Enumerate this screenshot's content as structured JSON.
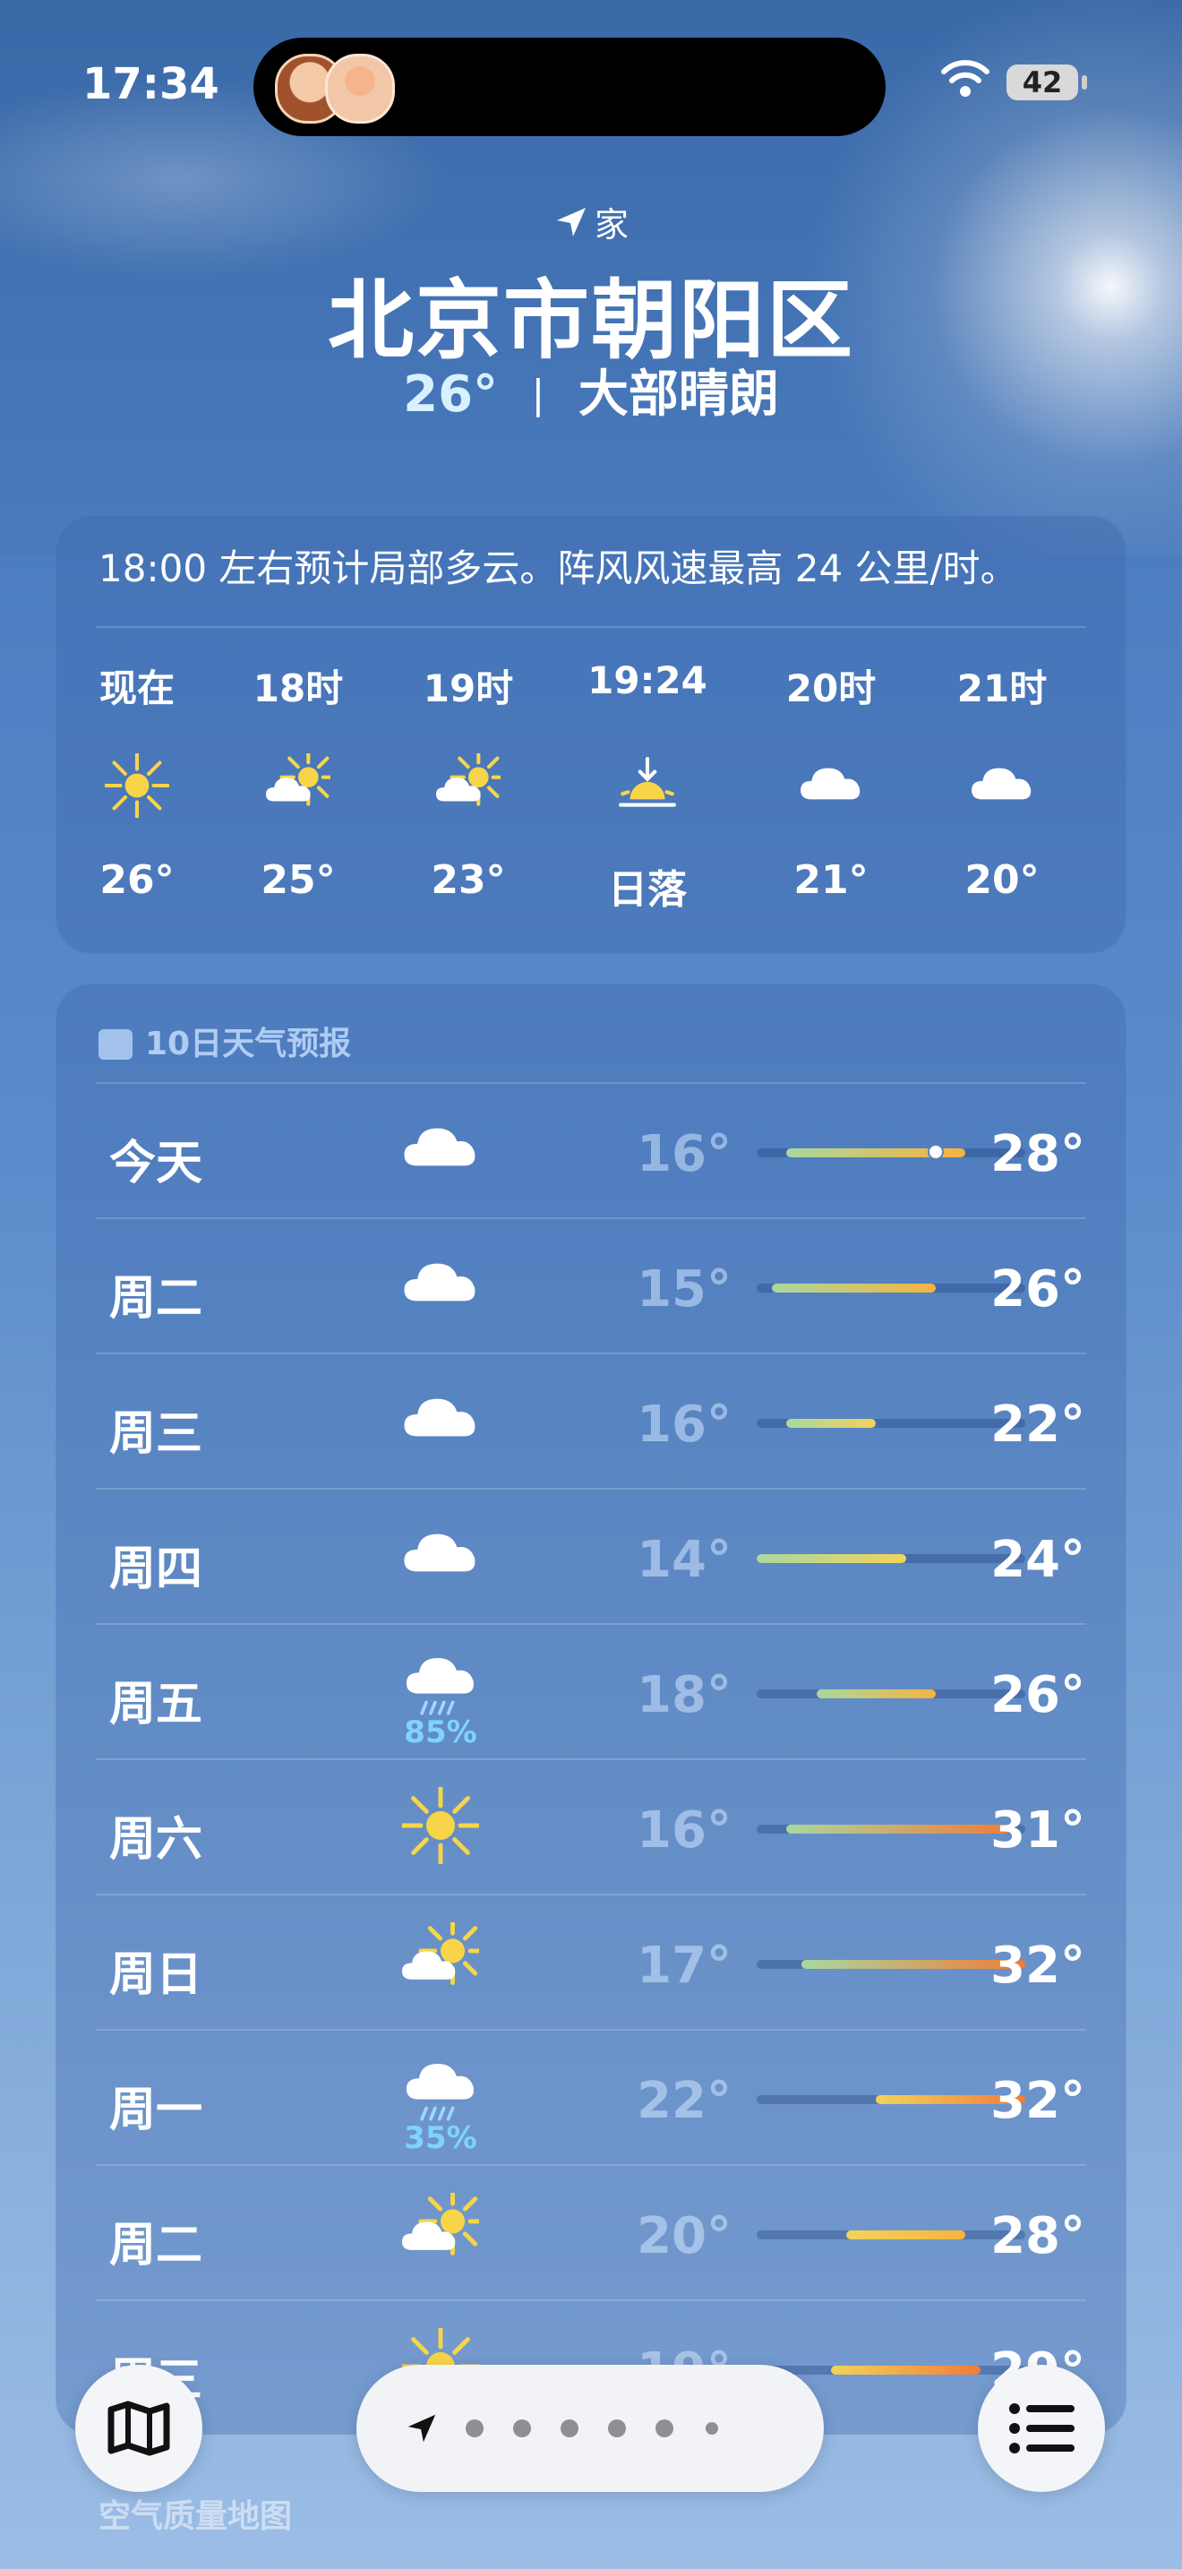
{
  "status": {
    "time": "17:34",
    "battery": "42"
  },
  "header": {
    "location_label": "家",
    "city": "北京市朝阳区",
    "current_temp": "26°",
    "separator": "|",
    "condition": "大部晴朗"
  },
  "hourly": {
    "summary": "18:00 左右预计局部多云。阵风风速最高 24 公里/时。",
    "items": [
      {
        "label": "现在",
        "icon": "sun-icon",
        "temp": "26°"
      },
      {
        "label": "18时",
        "icon": "partly-sunny-icon",
        "temp": "25°"
      },
      {
        "label": "19时",
        "icon": "partly-sunny-icon",
        "temp": "23°"
      },
      {
        "label": "19:24",
        "icon": "sunset-icon",
        "temp": "日落"
      },
      {
        "label": "20时",
        "icon": "cloud-icon",
        "temp": "21°"
      },
      {
        "label": "21时",
        "icon": "cloud-icon",
        "temp": "20°"
      }
    ]
  },
  "daily": {
    "title": "10日天气预报",
    "range": [
      14,
      32
    ],
    "current_temp_value": 26,
    "days": [
      {
        "name": "今天",
        "icon": "cloud-icon",
        "precip": "",
        "low": "16°",
        "high": "28°",
        "low_v": 16,
        "high_v": 28
      },
      {
        "name": "周二",
        "icon": "cloud-icon",
        "precip": "",
        "low": "15°",
        "high": "26°",
        "low_v": 15,
        "high_v": 26
      },
      {
        "name": "周三",
        "icon": "cloud-icon",
        "precip": "",
        "low": "16°",
        "high": "22°",
        "low_v": 16,
        "high_v": 22
      },
      {
        "name": "周四",
        "icon": "cloud-icon",
        "precip": "",
        "low": "14°",
        "high": "24°",
        "low_v": 14,
        "high_v": 24
      },
      {
        "name": "周五",
        "icon": "rain-icon",
        "precip": "85%",
        "low": "18°",
        "high": "26°",
        "low_v": 18,
        "high_v": 26
      },
      {
        "name": "周六",
        "icon": "sun-icon",
        "precip": "",
        "low": "16°",
        "high": "31°",
        "low_v": 16,
        "high_v": 31
      },
      {
        "name": "周日",
        "icon": "partly-sunny-icon",
        "precip": "",
        "low": "17°",
        "high": "32°",
        "low_v": 17,
        "high_v": 32
      },
      {
        "name": "周一",
        "icon": "rain-icon",
        "precip": "35%",
        "low": "22°",
        "high": "32°",
        "low_v": 22,
        "high_v": 32
      },
      {
        "name": "周二",
        "icon": "partly-sunny-icon",
        "precip": "",
        "low": "20°",
        "high": "28°",
        "low_v": 20,
        "high_v": 28
      },
      {
        "name": "周三",
        "icon": "sun-icon",
        "precip": "",
        "low": "19°",
        "high": "29°",
        "low_v": 19,
        "high_v": 29
      }
    ]
  },
  "air_quality": {
    "title": "空气质量地图"
  },
  "pager": {
    "page_count": 7,
    "current": 0
  }
}
